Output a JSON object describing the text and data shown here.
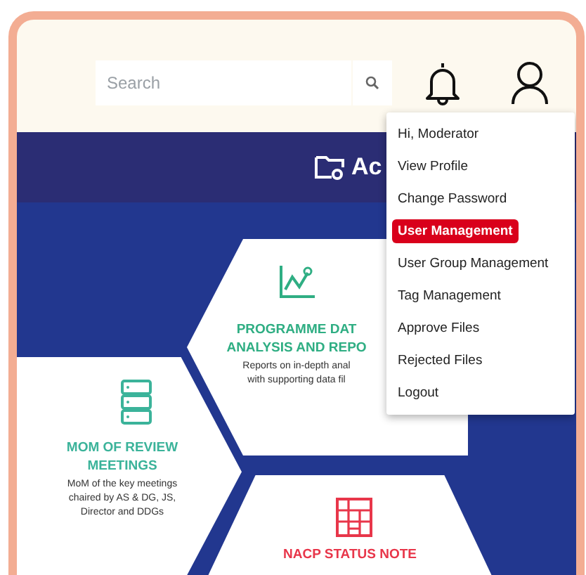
{
  "header": {
    "search": {
      "placeholder": "Search"
    }
  },
  "band": {
    "title": "Ac"
  },
  "tiles": [
    {
      "kind": "chart",
      "title": [
        "PROGRAMME DAT",
        "ANALYSIS AND REPO"
      ],
      "description": [
        "Reports on in-depth anal",
        "with supporting data fil"
      ],
      "color": "#2fae83"
    },
    {
      "kind": "server",
      "title": [
        "MOM OF REVIEW",
        "MEETINGS"
      ],
      "description": [
        "MoM of the key meetings",
        "chaired by AS & DG, JS,",
        "Director and DDGs"
      ],
      "color": "#3bb39a"
    },
    {
      "kind": "grid",
      "title": [
        "NACP STATUS NOTE"
      ],
      "color": "#e8364a"
    }
  ],
  "menu": [
    {
      "label": "Hi, Moderator",
      "selected": false
    },
    {
      "label": "View Profile",
      "selected": false
    },
    {
      "label": "Change Password",
      "selected": false
    },
    {
      "label": "User Management",
      "selected": true
    },
    {
      "label": "User Group Management",
      "selected": false
    },
    {
      "label": "Tag Management",
      "selected": false
    },
    {
      "label": "Approve Files",
      "selected": false
    },
    {
      "label": "Rejected Files",
      "selected": false
    },
    {
      "label": "Logout",
      "selected": false
    }
  ]
}
